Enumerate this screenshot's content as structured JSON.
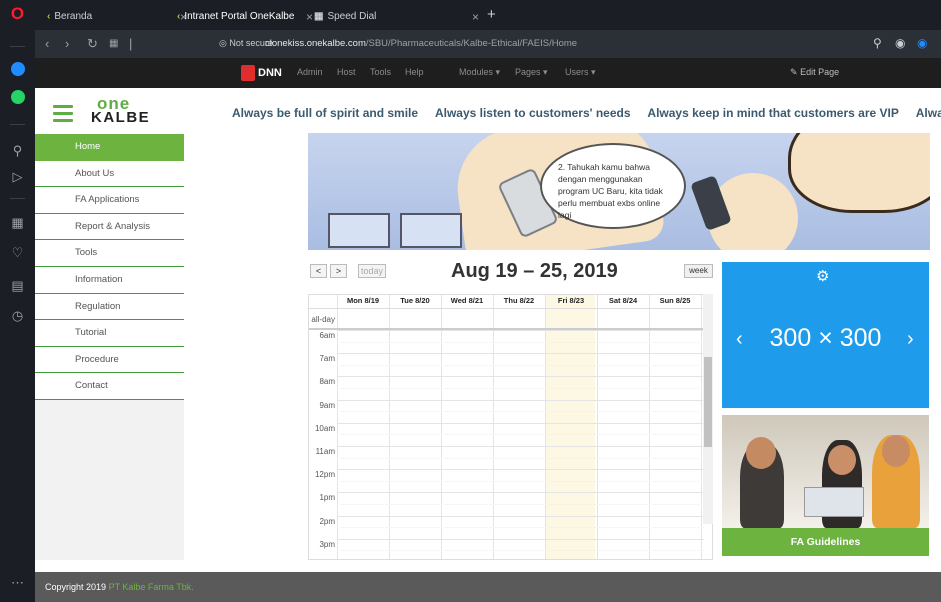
{
  "browser": {
    "tabs": [
      {
        "label": "Beranda"
      },
      {
        "label": "Intranet Portal OneKalbe"
      },
      {
        "label": "Speed Dial"
      }
    ],
    "new_tab": "+",
    "secure_label": "Not secure",
    "url_host": "clonekiss.onekalbe.com",
    "url_path": "/SBU/Pharmaceuticals/Kalbe-Ethical/FAEIS/Home"
  },
  "dnn": {
    "logo": "DNN",
    "items": [
      "Admin",
      "Host",
      "Tools",
      "Help",
      "Modules ▾",
      "Pages ▾",
      "Users ▾"
    ],
    "edit_page": "Edit Page"
  },
  "header": {
    "logo_top": "one",
    "logo_bottom": "KALBE",
    "marquee": [
      "Always be full of spirit and smile",
      "Always listen to customers' needs",
      "Always keep in mind that customers are VIP",
      "Always ne"
    ]
  },
  "menu": [
    {
      "label": "Home",
      "active": true
    },
    {
      "label": "About Us"
    },
    {
      "label": "FA Applications"
    },
    {
      "label": "Report & Analysis"
    },
    {
      "label": "Tools"
    },
    {
      "label": "Information"
    },
    {
      "label": "Regulation"
    },
    {
      "label": "Tutorial"
    },
    {
      "label": "Procedure"
    },
    {
      "label": "Contact"
    }
  ],
  "banner": {
    "bubble_text": "2. Tahukah kamu bahwa dengan menggunakan program UC Baru, kita tidak perlu membuat exbs online lagi"
  },
  "calendar": {
    "prev": "<",
    "next": ">",
    "today": "today",
    "title": "Aug 19 – 25, 2019",
    "view": "week",
    "all_day": "all-day",
    "days": [
      "Mon 8/19",
      "Tue 8/20",
      "Wed 8/21",
      "Thu 8/22",
      "Fri 8/23",
      "Sat 8/24",
      "Sun 8/25"
    ],
    "times": [
      "6am",
      "7am",
      "8am",
      "9am",
      "10am",
      "11am",
      "12pm",
      "1pm",
      "2pm",
      "3pm"
    ]
  },
  "ad": {
    "text": "300 × 300",
    "prev": "‹",
    "next": "›"
  },
  "fa_guidelines": "FA Guidelines",
  "footer": {
    "prefix": "Copyright 2019",
    "company": "PT Kalbe Farma Tbk."
  },
  "colors": {
    "accent_green": "#6db33f",
    "ad_blue": "#1f9bec",
    "dnn_red": "#e02d2d"
  }
}
